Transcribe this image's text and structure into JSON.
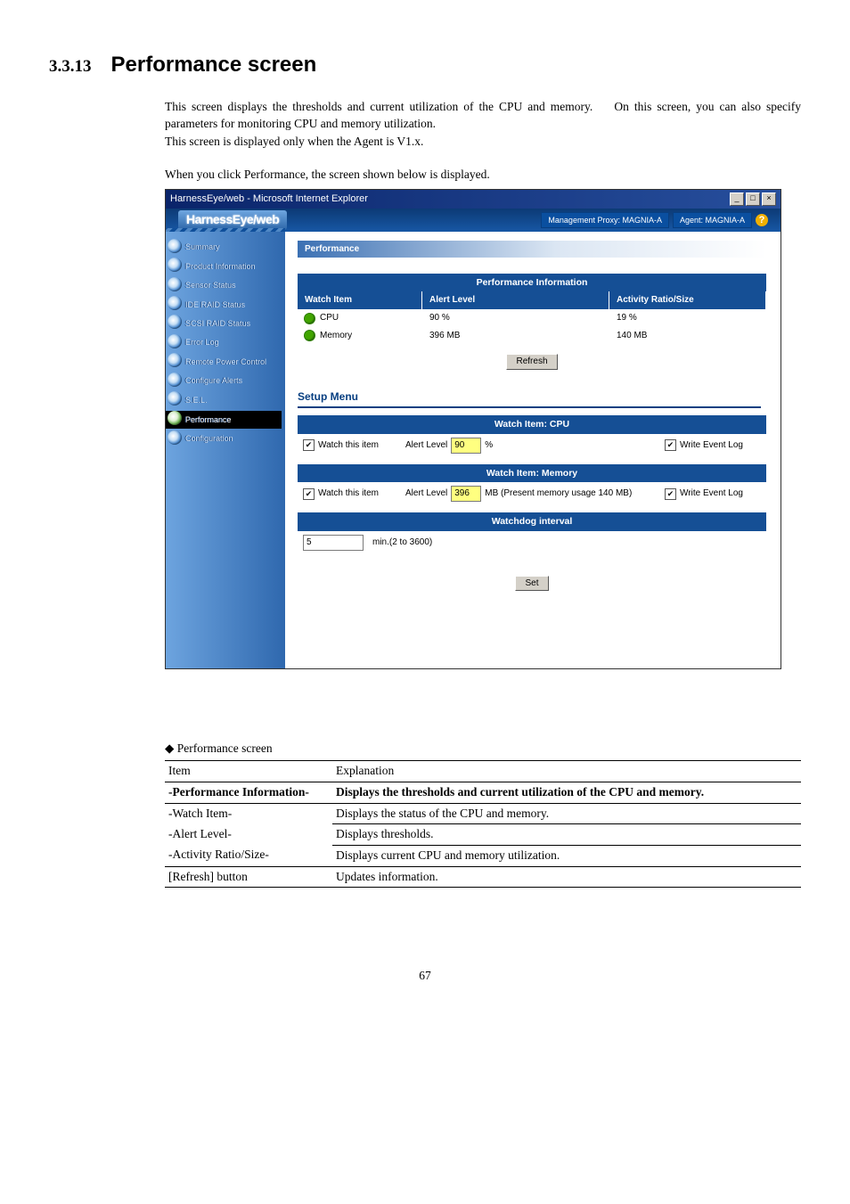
{
  "section": {
    "number": "3.3.13",
    "title": "Performance screen"
  },
  "paragraphs": {
    "p1a": "This screen displays the thresholds and current utilization of the CPU and memory.",
    "p1b": "On this screen, you can also specify parameters for monitoring CPU and memory utilization.",
    "p2": "This screen is displayed only when the Agent is V1.x.",
    "p3": "When you click Performance, the screen shown below is displayed."
  },
  "window": {
    "title": "HarnessEye/web - Microsoft Internet Explorer",
    "controls": {
      "min": "_",
      "max": "□",
      "close": "×"
    },
    "banner": {
      "logo": "HarnessEye/web",
      "proxy": "Management Proxy: MAGNIA-A",
      "agent": "Agent: MAGNIA-A",
      "help": "?"
    },
    "sidebar": {
      "items": [
        {
          "label": "Summary"
        },
        {
          "label": "Product Information"
        },
        {
          "label": "Sensor Status"
        },
        {
          "label": "IDE RAID Status"
        },
        {
          "label": "SCSI RAID Status"
        },
        {
          "label": "Error Log"
        },
        {
          "label": "Remote Power Control"
        },
        {
          "label": "Configure Alerts"
        },
        {
          "label": "S.E.L."
        },
        {
          "label": "Performance"
        },
        {
          "label": "Configuration"
        }
      ]
    },
    "content": {
      "panel_title": "Performance",
      "info_header": "Performance Information",
      "columns": {
        "c1": "Watch Item",
        "c2": "Alert Level",
        "c3": "Activity Ratio/Size"
      },
      "rows": [
        {
          "item": "CPU",
          "alert": "90 %",
          "value": "19 %"
        },
        {
          "item": "Memory",
          "alert": "396 MB",
          "value": "140 MB"
        }
      ],
      "refresh": "Refresh",
      "setup_title": "Setup Menu",
      "watch_cpu": {
        "title": "Watch Item: CPU",
        "watch_label": "Watch this item",
        "alert_label": "Alert Level",
        "alert_value": "90",
        "unit": "%",
        "log_label": "Write Event Log"
      },
      "watch_mem": {
        "title": "Watch Item: Memory",
        "watch_label": "Watch this item",
        "alert_label": "Alert Level",
        "alert_value": "396",
        "unit_note": "MB (Present memory usage 140 MB)",
        "log_label": "Write Event Log"
      },
      "watchdog": {
        "title": "Watchdog interval",
        "value": "5",
        "note": "min.(2 to 3600)"
      },
      "set": "Set"
    }
  },
  "ref": {
    "caption": "Performance screen",
    "head": {
      "c1": "Item",
      "c2": "Explanation"
    },
    "rows": [
      {
        "c1": "-Performance Information-",
        "c2": "Displays the thresholds and current utilization of the CPU and memory.",
        "bold": true
      },
      {
        "c1": "-Watch Item-",
        "c2": "Displays the status of the CPU and memory."
      },
      {
        "c1": "-Alert Level-",
        "c2": "Displays thresholds."
      },
      {
        "c1": "-Activity Ratio/Size-",
        "c2": "Displays current CPU and memory utilization."
      },
      {
        "c1": "[Refresh] button",
        "c2": "Updates information."
      }
    ]
  },
  "page_number": "67"
}
